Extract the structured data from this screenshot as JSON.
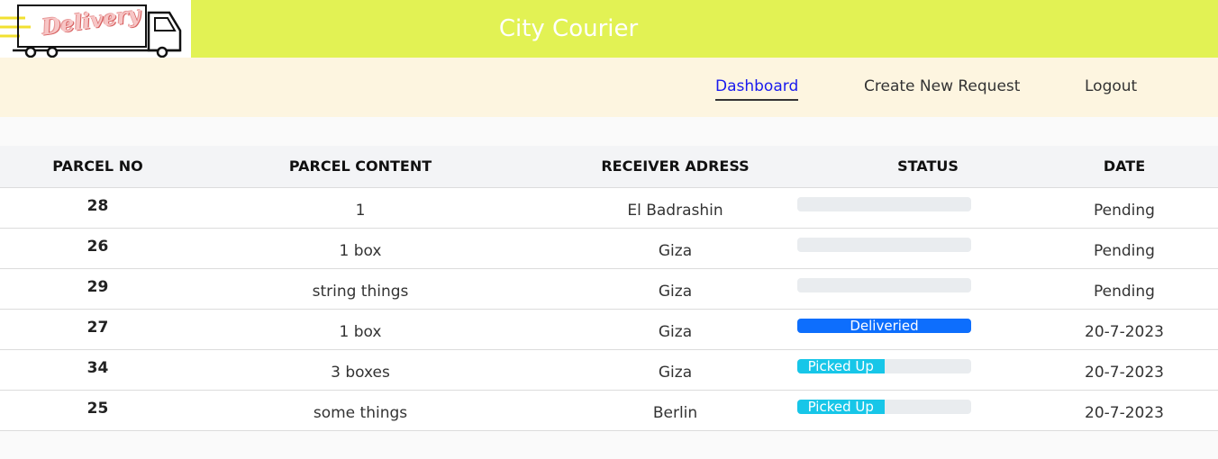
{
  "header": {
    "logo_word": "Delivery",
    "title": "City Courier",
    "bg_color": "#e2f254"
  },
  "nav": {
    "dashboard": "Dashboard",
    "create": "Create New Request",
    "logout": "Logout",
    "active": "dashboard"
  },
  "table": {
    "columns": [
      "PARCEL NO",
      "PARCEL CONTENT",
      "RECEIVER ADRESS",
      "STATUS",
      "DATE"
    ],
    "rows": [
      {
        "parcel_no": "28",
        "content": "1",
        "address": "El Badrashin",
        "status": "",
        "status_progress": 0,
        "status_color": "",
        "date": "Pending"
      },
      {
        "parcel_no": "26",
        "content": "1 box",
        "address": "Giza",
        "status": "",
        "status_progress": 0,
        "status_color": "",
        "date": "Pending"
      },
      {
        "parcel_no": "29",
        "content": "string things",
        "address": "Giza",
        "status": "",
        "status_progress": 0,
        "status_color": "",
        "date": "Pending"
      },
      {
        "parcel_no": "27",
        "content": "1 box",
        "address": "Giza",
        "status": "Deliveried",
        "status_progress": 100,
        "status_color": "#0d6efd",
        "date": "20-7-2023"
      },
      {
        "parcel_no": "34",
        "content": "3 boxes",
        "address": "Giza",
        "status": "Picked Up",
        "status_progress": 50,
        "status_color": "#17c6e8",
        "date": "20-7-2023"
      },
      {
        "parcel_no": "25",
        "content": "some things",
        "address": "Berlin",
        "status": "Picked Up",
        "status_progress": 50,
        "status_color": "#17c6e8",
        "date": "20-7-2023"
      }
    ]
  }
}
